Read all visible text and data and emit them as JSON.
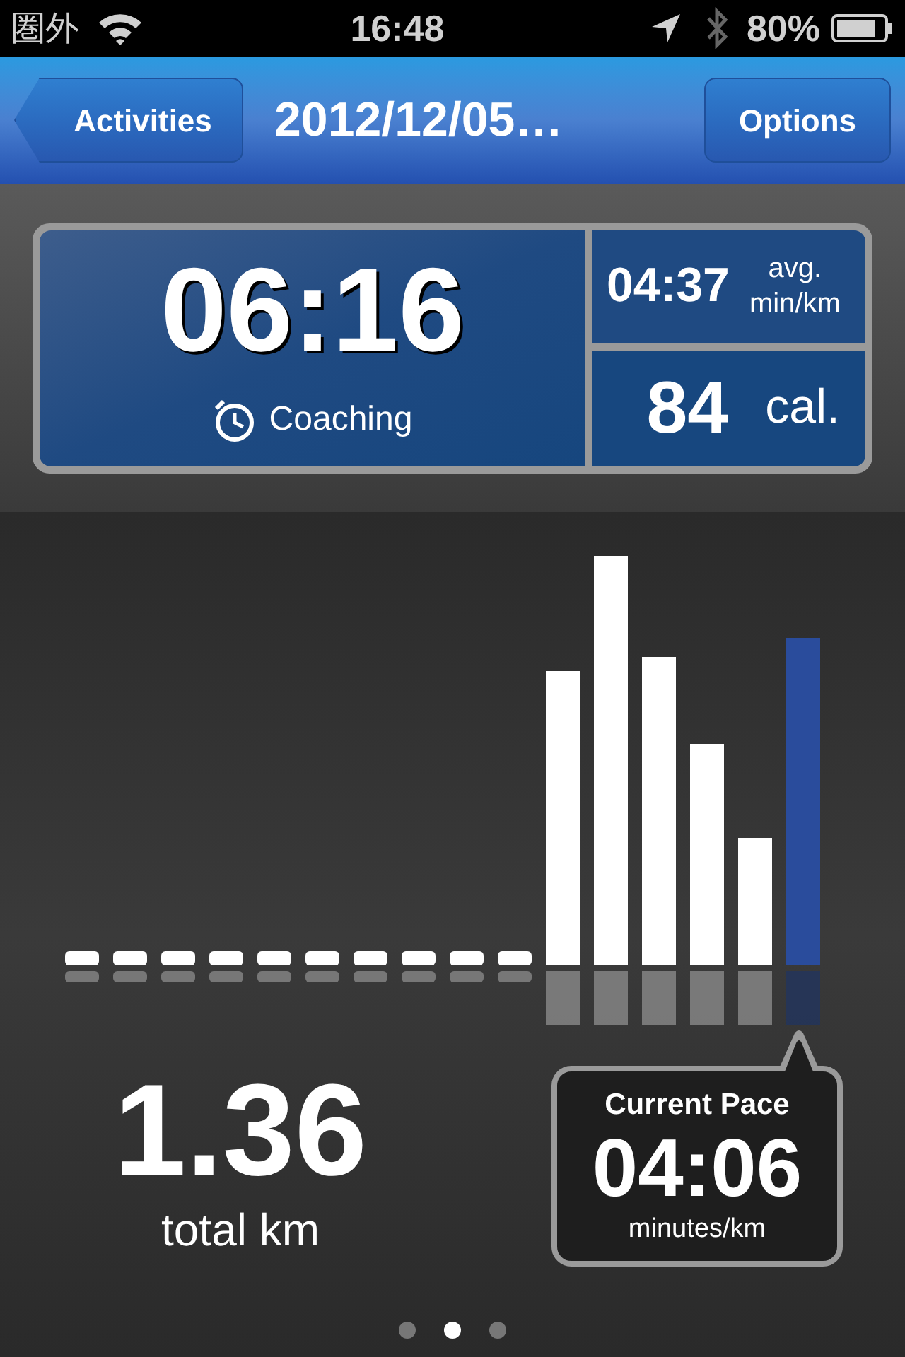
{
  "status_bar": {
    "carrier": "圏外",
    "time": "16:48",
    "battery": "80%"
  },
  "nav": {
    "back": "Activities",
    "title": "2012/12/05…",
    "options": "Options"
  },
  "summary": {
    "duration": "06:16",
    "coaching": "Coaching",
    "avg_pace": "04:37",
    "avg_label_1": "avg.",
    "avg_label_2": "min/km",
    "calories": "84",
    "calories_unit": "cal."
  },
  "distance": {
    "value": "1.36",
    "unit": "total km"
  },
  "current_pace": {
    "title": "Current Pace",
    "value": "04:06",
    "unit": "minutes/km"
  },
  "pages": [
    {
      "selected": false
    },
    {
      "selected": true
    },
    {
      "selected": false
    }
  ]
}
